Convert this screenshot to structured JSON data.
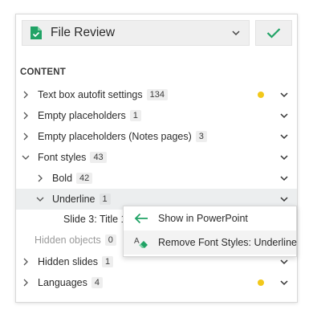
{
  "header": {
    "title": "File Review"
  },
  "section": {
    "title": "CONTENT"
  },
  "colors": {
    "accent_green": "#21a366",
    "warning_dot": "#f2c81a"
  },
  "rows": [
    {
      "label": "Text box autofit settings",
      "count": "134",
      "expanded": false,
      "dot": true
    },
    {
      "label": "Empty placeholders",
      "count": "1",
      "expanded": false,
      "dot": false
    },
    {
      "label": "Empty placeholders (Notes pages)",
      "count": "3",
      "expanded": false,
      "dot": false
    },
    {
      "label": "Font styles",
      "count": "43",
      "expanded": true,
      "dot": false
    },
    {
      "label": "Bold",
      "count": "42",
      "expanded": false,
      "dot": false
    },
    {
      "label": "Underline",
      "count": "1",
      "expanded": true,
      "dot": false
    },
    {
      "label": "Slide 3: Title 1"
    },
    {
      "label": "Hidden objects",
      "count": "0"
    },
    {
      "label": "Hidden slides",
      "count": "1",
      "expanded": false,
      "dot": false
    },
    {
      "label": "Languages",
      "count": "4",
      "expanded": false,
      "dot": true
    }
  ],
  "context_menu": {
    "items": [
      {
        "label": "Show in PowerPoint",
        "icon": "arrow-left-icon"
      },
      {
        "label": "Remove Font Styles: Underline",
        "icon": "clear-format-icon"
      }
    ]
  }
}
